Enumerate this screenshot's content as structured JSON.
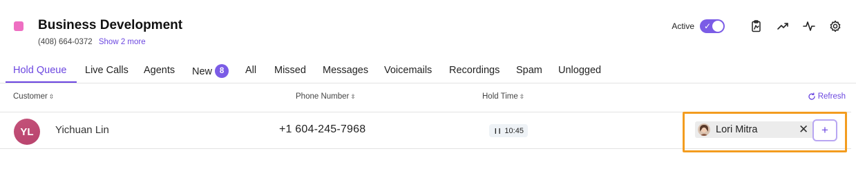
{
  "header": {
    "accent_color": "#ee6fc2",
    "title": "Business Development",
    "phone": "(408) 664-0372",
    "show_more": "Show 2 more",
    "active_label": "Active",
    "active_toggle_on": true,
    "icons": [
      "clipboard-icon",
      "trend-icon",
      "activity-icon",
      "gear-icon"
    ]
  },
  "tabs": [
    {
      "label": "Hold Queue",
      "active": true
    },
    {
      "label": "Live Calls"
    },
    {
      "label": "Agents"
    },
    {
      "label": "New",
      "badge": "8"
    },
    {
      "label": "All"
    },
    {
      "label": "Missed"
    },
    {
      "label": "Messages"
    },
    {
      "label": "Voicemails"
    },
    {
      "label": "Recordings"
    },
    {
      "label": "Spam"
    },
    {
      "label": "Unlogged"
    }
  ],
  "table": {
    "columns": {
      "customer": "Customer",
      "phone": "Phone Number",
      "hold_time": "Hold Time"
    },
    "refresh_label": "Refresh",
    "rows": [
      {
        "initials": "YL",
        "name": "Yichuan Lin",
        "phone": "+1 604-245-7968",
        "hold_time": "10:45",
        "agent": "Lori Mitra",
        "add_label": "+"
      }
    ]
  },
  "colors": {
    "brand_purple": "#6b46e0",
    "highlight_orange": "#f39c1f"
  }
}
